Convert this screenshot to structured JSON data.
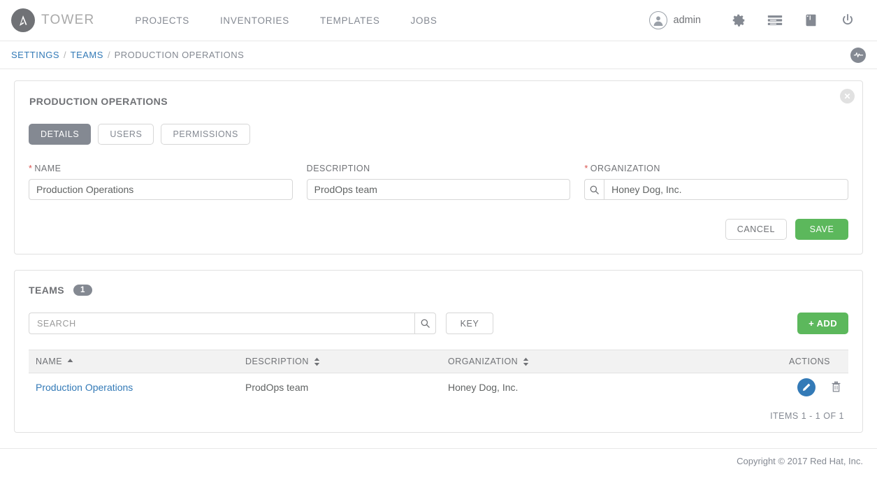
{
  "header": {
    "brand": "TOWER",
    "brand_logo_icon": "tower-logo-icon",
    "nav": [
      {
        "label": "PROJECTS"
      },
      {
        "label": "INVENTORIES"
      },
      {
        "label": "TEMPLATES"
      },
      {
        "label": "JOBS"
      }
    ],
    "user": "admin",
    "icons": [
      {
        "name": "gear-icon"
      },
      {
        "name": "jobs-list-icon"
      },
      {
        "name": "book-icon"
      },
      {
        "name": "power-icon"
      }
    ]
  },
  "breadcrumb": {
    "items": [
      {
        "label": "SETTINGS",
        "link": true
      },
      {
        "label": "TEAMS",
        "link": true
      },
      {
        "label": "PRODUCTION OPERATIONS",
        "link": false
      }
    ],
    "separator": "/",
    "activity_icon": "activity-stream-icon"
  },
  "details": {
    "title": "PRODUCTION OPERATIONS",
    "close_icon": "close-icon",
    "tabs": [
      {
        "label": "DETAILS",
        "active": true
      },
      {
        "label": "USERS",
        "active": false
      },
      {
        "label": "PERMISSIONS",
        "active": false
      }
    ],
    "fields": {
      "name": {
        "label": "NAME",
        "required": true,
        "value": "Production Operations"
      },
      "description": {
        "label": "DESCRIPTION",
        "required": false,
        "value": "ProdOps team"
      },
      "organization": {
        "label": "ORGANIZATION",
        "required": true,
        "value": "Honey Dog, Inc.",
        "lookup_icon": "search-icon"
      }
    },
    "buttons": {
      "cancel": "CANCEL",
      "save": "SAVE"
    }
  },
  "list": {
    "title": "TEAMS",
    "count": "1",
    "search_placeholder": "SEARCH",
    "search_icon": "search-icon",
    "key_label": "KEY",
    "add_label": "+ ADD",
    "columns": [
      {
        "label": "NAME",
        "sort": "asc"
      },
      {
        "label": "DESCRIPTION",
        "sort": "none"
      },
      {
        "label": "ORGANIZATION",
        "sort": "none"
      },
      {
        "label": "ACTIONS",
        "sort": null
      }
    ],
    "rows": [
      {
        "name": "Production Operations",
        "description": "ProdOps team",
        "organization": "Honey Dog, Inc.",
        "edit_icon": "pencil-icon",
        "delete_icon": "trash-icon"
      }
    ],
    "items_count": "ITEMS  1 - 1 OF 1"
  },
  "footer": {
    "copyright": "Copyright © 2017 Red Hat, Inc."
  },
  "colors": {
    "accent_green": "#5cb85c",
    "accent_blue": "#337ab7",
    "gray": "#848992",
    "required_red": "#d9534f"
  }
}
